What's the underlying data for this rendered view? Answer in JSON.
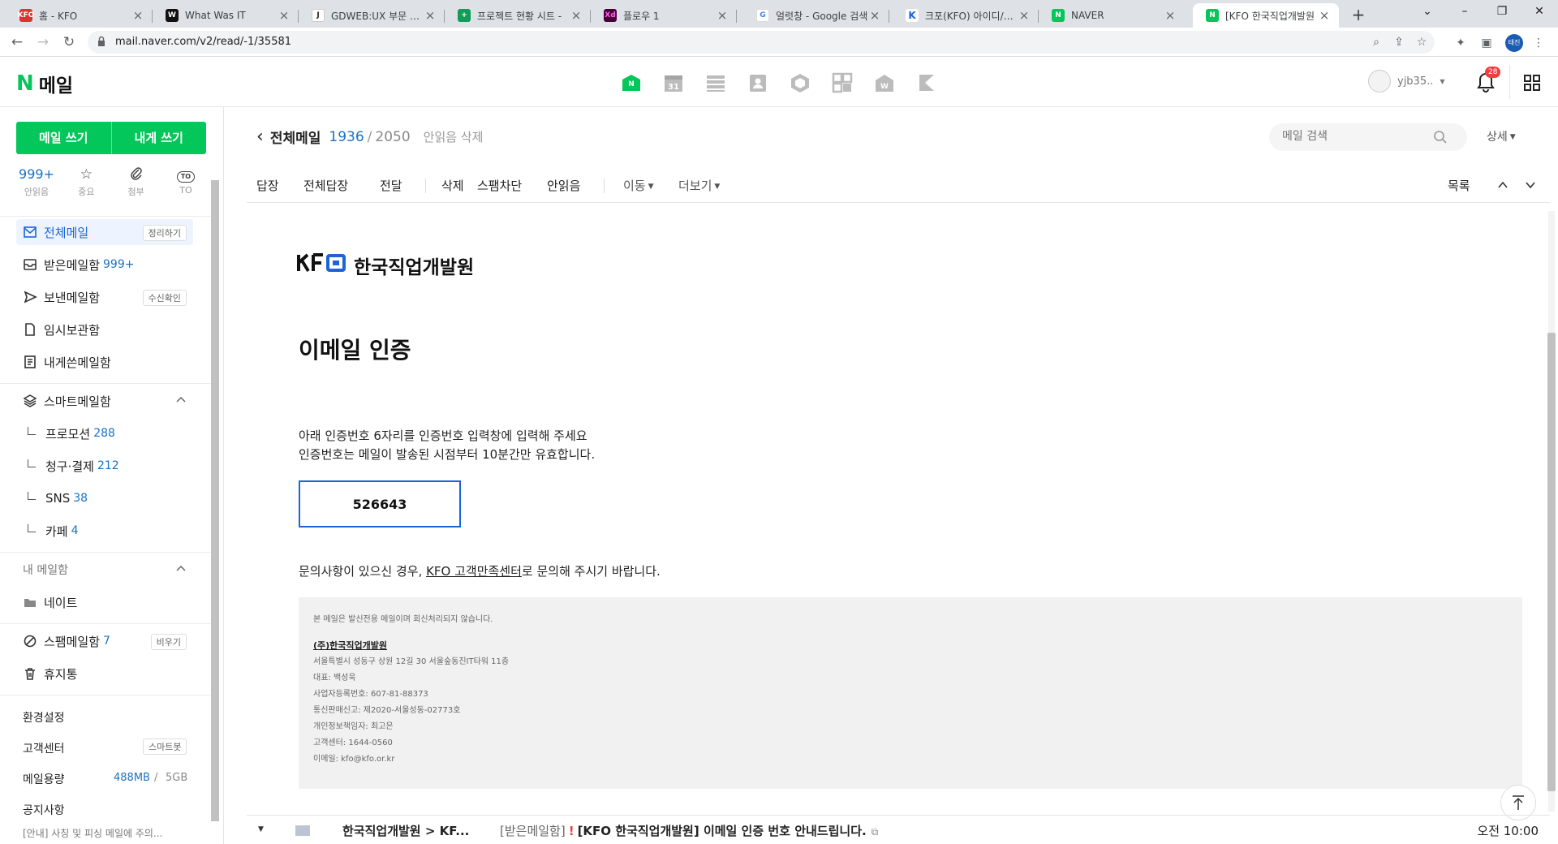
{
  "browser": {
    "tabs": [
      {
        "title": "홈 - KFO",
        "favicon": "kfo-favicon",
        "fav_text": "KFO",
        "color": "#e03131"
      },
      {
        "title": "What Was IT",
        "favicon": "w-favicon",
        "fav_text": "W",
        "color": "#111111"
      },
      {
        "title": "GDWEB:UX 부문 선정",
        "favicon": "gdweb-favicon",
        "fav_text": "J",
        "color": "#222222"
      },
      {
        "title": "프로젝트 현황 시트 -",
        "favicon": "sheets-favicon",
        "fav_text": "+",
        "color": "#0f9d58"
      },
      {
        "title": "플로우 1",
        "favicon": "xd-favicon",
        "fav_text": "Xd",
        "color": "#470137"
      },
      {
        "title": "얼럿창 - Google 검색",
        "favicon": "google-favicon",
        "fav_text": "G",
        "color": "#4285f4"
      },
      {
        "title": "크포(KFO) 아이디/비밀",
        "favicon": "k-favicon",
        "fav_text": "K",
        "color": "#1c64d8"
      },
      {
        "title": "NAVER",
        "favicon": "naver-favicon",
        "fav_text": "N",
        "color": "#03c75a"
      },
      {
        "title": "[KFO 한국직업개발원",
        "favicon": "naver-mail-favicon",
        "fav_text": "N",
        "color": "#03c75a"
      }
    ],
    "url": "mail.naver.com/v2/read/-1/35581",
    "profile_label": "태진"
  },
  "header": {
    "logo_n": "N",
    "logo_text": "메일",
    "services": [
      "mail-icon",
      "calendar-icon",
      "table-icon",
      "contacts-icon",
      "cube-icon",
      "apps-icon",
      "myBox-icon",
      "keep-icon"
    ],
    "calendar_day": "31",
    "user_name": "yjb35..",
    "notif_count": "28"
  },
  "sidebar": {
    "write_label": "메일 쓰기",
    "self_write_label": "내게 쓰기",
    "quick": [
      {
        "value": "999+",
        "label": "안읽음"
      },
      {
        "icon": "☆",
        "label": "중요"
      },
      {
        "icon": "📎",
        "label": "첨부"
      },
      {
        "icon": "TO",
        "label": "TO"
      }
    ],
    "all_mail": {
      "label": "전체메일",
      "tag": "정리하기"
    },
    "inbox": {
      "label": "받은메일함",
      "count": "999+"
    },
    "sent": {
      "label": "보낸메일함",
      "tag": "수신확인"
    },
    "drafts": {
      "label": "임시보관함"
    },
    "self": {
      "label": "내게쓴메일함"
    },
    "smart": {
      "label": "스마트메일함"
    },
    "smart_items": [
      {
        "label": "프로모션",
        "count": "288"
      },
      {
        "label": "청구·결제",
        "count": "212"
      },
      {
        "label": "SNS",
        "count": "38"
      },
      {
        "label": "카페",
        "count": "4"
      }
    ],
    "my_box": {
      "label": "내 메일함"
    },
    "my_box_items": [
      {
        "label": "네이트"
      }
    ],
    "spam": {
      "label": "스팸메일함",
      "count": "7",
      "tag": "비우기"
    },
    "trash": {
      "label": "휴지통"
    },
    "settings": "환경설정",
    "support": {
      "label": "고객센터",
      "tag": "스마트봇"
    },
    "capacity": {
      "label": "메일용량",
      "used": "488MB",
      "sep": "/",
      "total": "5GB"
    },
    "notice": "공지사항",
    "notice_text": "[안내] 사칭 및 피싱 메일에 주의..."
  },
  "main": {
    "folder": "전체메일",
    "current": "1936",
    "sep": "/",
    "total": "2050",
    "delete_unread": "안읽음 삭제",
    "search_placeholder": "메일 검색",
    "detail": "상세",
    "toolbar": {
      "reply": "답장",
      "reply_all": "전체답장",
      "forward": "전달",
      "delete": "삭제",
      "block_spam": "스팸차단",
      "unread": "안읽음",
      "move": "이동",
      "more": "더보기",
      "list": "목록"
    }
  },
  "mail": {
    "logo_mark": "KFO",
    "logo_name": "한국직업개발원",
    "heading": "이메일 인증",
    "desc_line1": "아래 인증번호 6자리를 인증번호 입력창에 입력해 주세요",
    "desc_line2": "인증번호는 메일이 발송된 시점부터 10분간만 유효합니다.",
    "code": "526643",
    "inquiry_pre": "문의사항이 있으신 경우, ",
    "inquiry_link": "KFO 고객만족센터",
    "inquiry_post": "로 문의해 주시기 바랍니다.",
    "footer": {
      "notice": "본 메일은 발신전용 메일이며 회신처리되지 않습니다.",
      "company": "(주)한국직업개발원",
      "address": "서울특별시 성동구 상원 12길 30 서울숲동진IT타워 11층",
      "ceo": "대표: 백성욱",
      "biz_no": "사업자등록번호: 607-81-88373",
      "telecom": "통신판매신고: 제2020-서울성동-02773호",
      "privacy": "개인정보책임자: 최고은",
      "center": "고객센터: 1644-0560",
      "email": "이메일: kfo@kfo.or.kr"
    }
  },
  "next_mail": {
    "sender": "한국직업개발원 > KF...",
    "folder": "[받은메일함]",
    "important": "!",
    "subject": "[KFO 한국직업개발원] 이메일 인증 번호 안내드립니다.",
    "time": "오전 10:00"
  }
}
